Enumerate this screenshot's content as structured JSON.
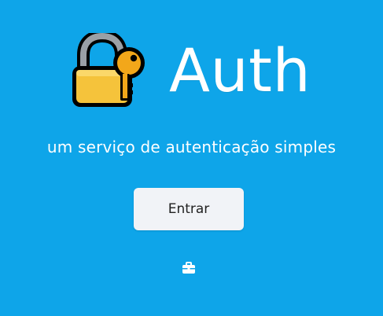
{
  "header": {
    "title": "Auth",
    "tagline": "um serviço de autenticação simples",
    "logo_icon": "lock-with-key-icon"
  },
  "actions": {
    "enter_label": "Entrar"
  },
  "footer": {
    "icon": "briefcase-icon"
  },
  "colors": {
    "background": "#0ea5e9",
    "button_background": "#f1f3f7",
    "button_text": "#222222",
    "title_text": "#ffffff",
    "lock_body": "#f5c33b",
    "key": "#f2a71a"
  }
}
